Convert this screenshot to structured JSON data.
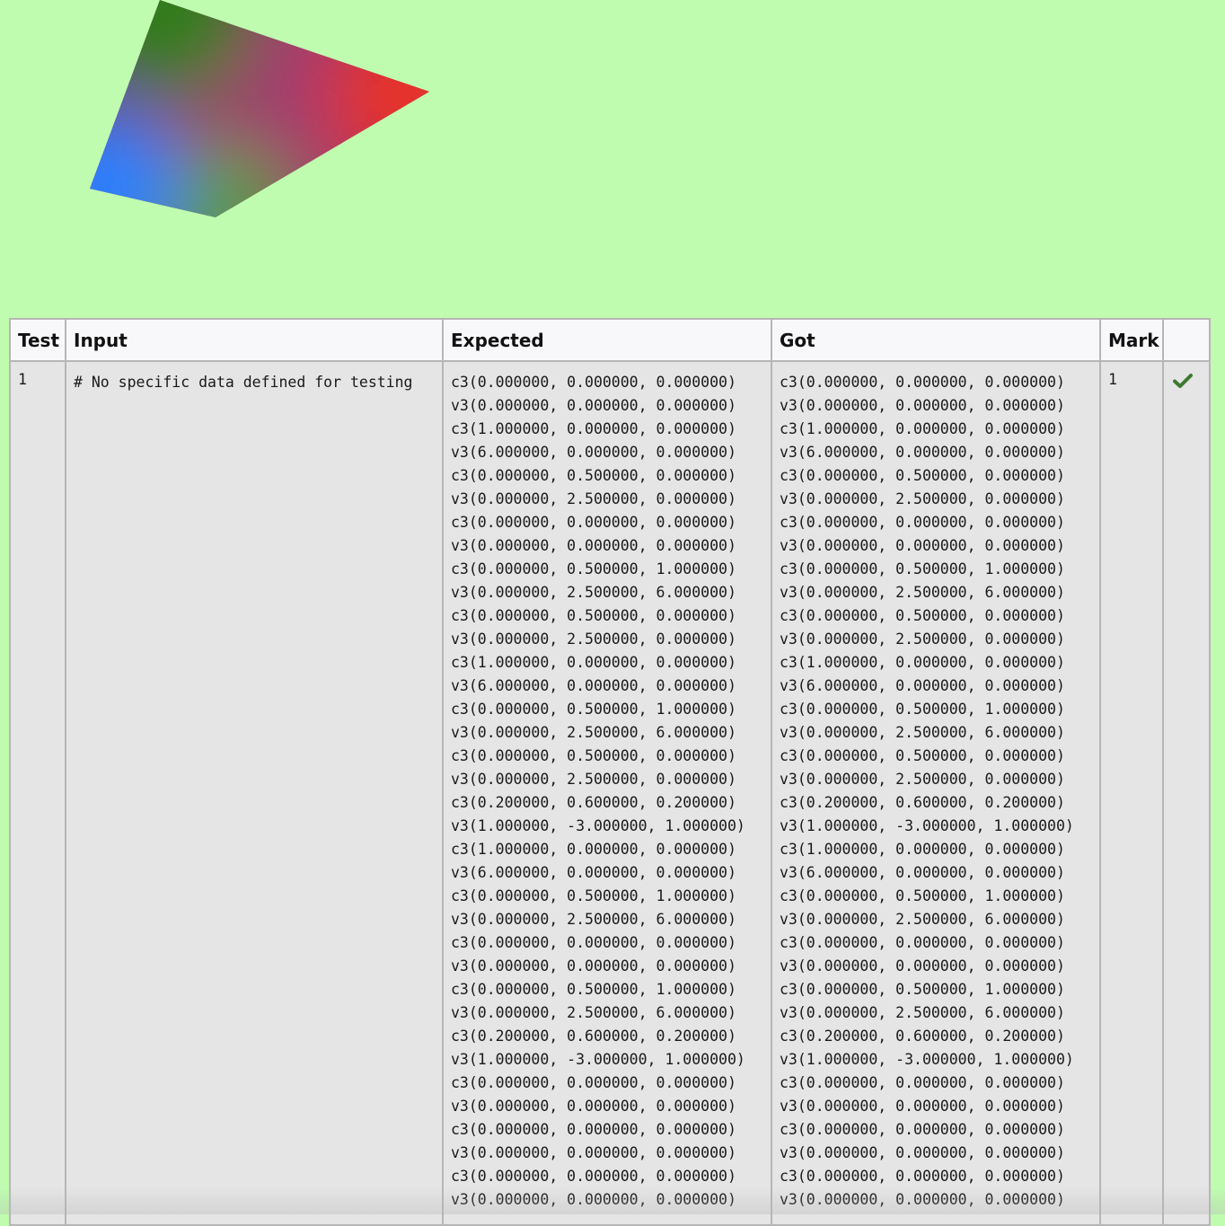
{
  "canvas": {
    "background": "#bffcb0",
    "vertex_colors": {
      "top": "#327d1e",
      "right": "#e6302a",
      "bottom": "#5b9a4a",
      "left": "#2a80ff",
      "center": "#a03c6e"
    }
  },
  "table": {
    "headers": {
      "test": "Test",
      "input": "Input",
      "expected": "Expected",
      "got": "Got",
      "mark": "Mark",
      "status": ""
    },
    "rows": [
      {
        "test": "1",
        "input": "# No specific data defined for testing",
        "expected": [
          "c3(0.000000, 0.000000, 0.000000)",
          "v3(0.000000, 0.000000, 0.000000)",
          "c3(1.000000, 0.000000, 0.000000)",
          "v3(6.000000, 0.000000, 0.000000)",
          "c3(0.000000, 0.500000, 0.000000)",
          "v3(0.000000, 2.500000, 0.000000)",
          "c3(0.000000, 0.000000, 0.000000)",
          "v3(0.000000, 0.000000, 0.000000)",
          "c3(0.000000, 0.500000, 1.000000)",
          "v3(0.000000, 2.500000, 6.000000)",
          "c3(0.000000, 0.500000, 0.000000)",
          "v3(0.000000, 2.500000, 0.000000)",
          "c3(1.000000, 0.000000, 0.000000)",
          "v3(6.000000, 0.000000, 0.000000)",
          "c3(0.000000, 0.500000, 1.000000)",
          "v3(0.000000, 2.500000, 6.000000)",
          "c3(0.000000, 0.500000, 0.000000)",
          "v3(0.000000, 2.500000, 0.000000)",
          "c3(0.200000, 0.600000, 0.200000)",
          "v3(1.000000, -3.000000, 1.000000)",
          "c3(1.000000, 0.000000, 0.000000)",
          "v3(6.000000, 0.000000, 0.000000)",
          "c3(0.000000, 0.500000, 1.000000)",
          "v3(0.000000, 2.500000, 6.000000)",
          "c3(0.000000, 0.000000, 0.000000)",
          "v3(0.000000, 0.000000, 0.000000)",
          "c3(0.000000, 0.500000, 1.000000)",
          "v3(0.000000, 2.500000, 6.000000)",
          "c3(0.200000, 0.600000, 0.200000)",
          "v3(1.000000, -3.000000, 1.000000)",
          "c3(0.000000, 0.000000, 0.000000)",
          "v3(0.000000, 0.000000, 0.000000)",
          "c3(0.000000, 0.000000, 0.000000)",
          "v3(0.000000, 0.000000, 0.000000)",
          "c3(0.000000, 0.000000, 0.000000)",
          "v3(0.000000, 0.000000, 0.000000)"
        ],
        "got": [
          "c3(0.000000, 0.000000, 0.000000)",
          "v3(0.000000, 0.000000, 0.000000)",
          "c3(1.000000, 0.000000, 0.000000)",
          "v3(6.000000, 0.000000, 0.000000)",
          "c3(0.000000, 0.500000, 0.000000)",
          "v3(0.000000, 2.500000, 0.000000)",
          "c3(0.000000, 0.000000, 0.000000)",
          "v3(0.000000, 0.000000, 0.000000)",
          "c3(0.000000, 0.500000, 1.000000)",
          "v3(0.000000, 2.500000, 6.000000)",
          "c3(0.000000, 0.500000, 0.000000)",
          "v3(0.000000, 2.500000, 0.000000)",
          "c3(1.000000, 0.000000, 0.000000)",
          "v3(6.000000, 0.000000, 0.000000)",
          "c3(0.000000, 0.500000, 1.000000)",
          "v3(0.000000, 2.500000, 6.000000)",
          "c3(0.000000, 0.500000, 0.000000)",
          "v3(0.000000, 2.500000, 0.000000)",
          "c3(0.200000, 0.600000, 0.200000)",
          "v3(1.000000, -3.000000, 1.000000)",
          "c3(1.000000, 0.000000, 0.000000)",
          "v3(6.000000, 0.000000, 0.000000)",
          "c3(0.000000, 0.500000, 1.000000)",
          "v3(0.000000, 2.500000, 6.000000)",
          "c3(0.000000, 0.000000, 0.000000)",
          "v3(0.000000, 0.000000, 0.000000)",
          "c3(0.000000, 0.500000, 1.000000)",
          "v3(0.000000, 2.500000, 6.000000)",
          "c3(0.200000, 0.600000, 0.200000)",
          "v3(1.000000, -3.000000, 1.000000)",
          "c3(0.000000, 0.000000, 0.000000)",
          "v3(0.000000, 0.000000, 0.000000)",
          "c3(0.000000, 0.000000, 0.000000)",
          "v3(0.000000, 0.000000, 0.000000)",
          "c3(0.000000, 0.000000, 0.000000)",
          "v3(0.000000, 0.000000, 0.000000)"
        ],
        "mark": "1",
        "status_icon": "checkmark-icon",
        "status_color": "#3c7a2f"
      }
    ]
  }
}
